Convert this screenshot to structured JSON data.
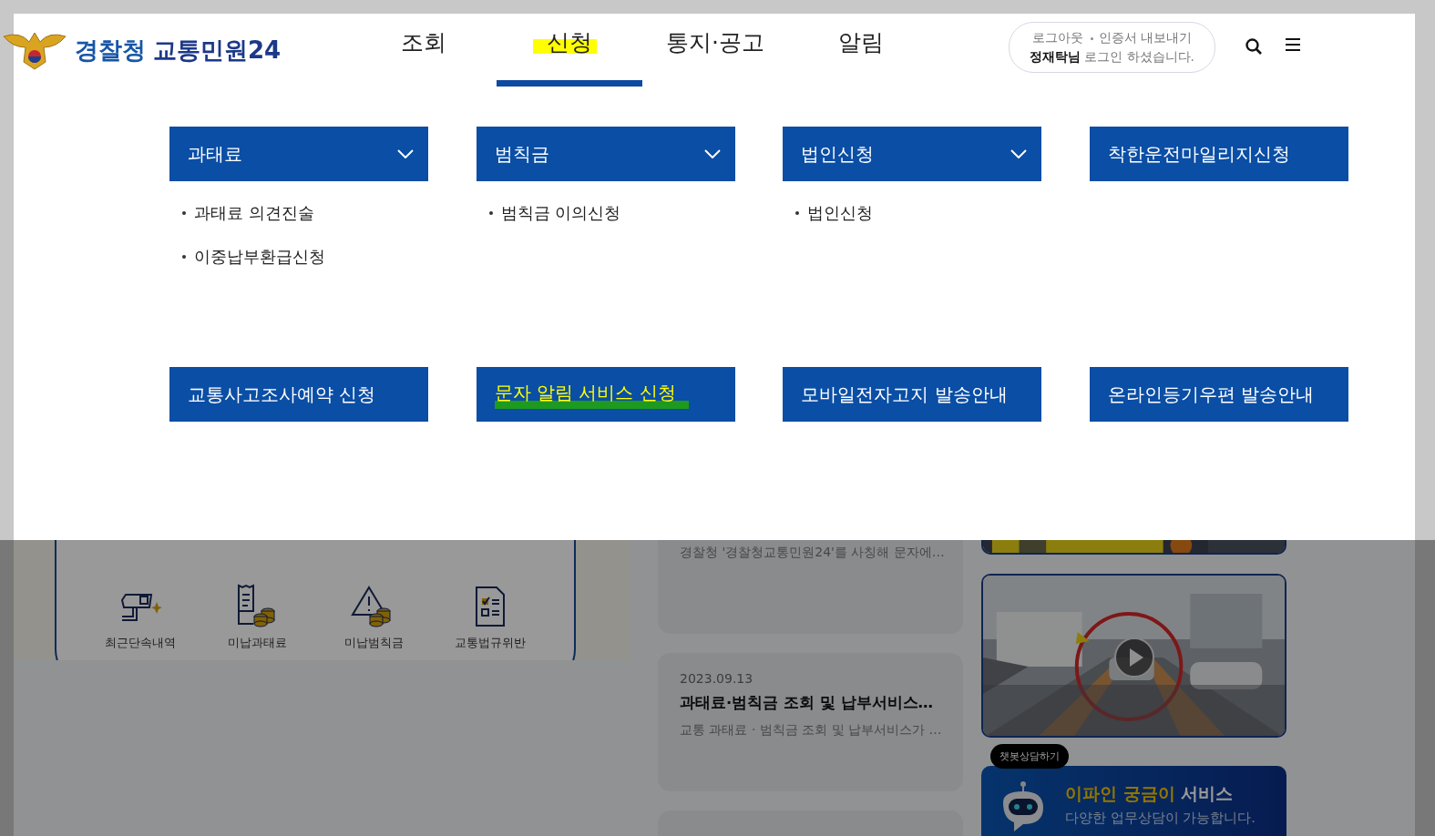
{
  "logo": {
    "agency": "경찰청",
    "service": "교통민원24"
  },
  "nav": [
    {
      "label": "조회",
      "selected": false,
      "highlighted": false
    },
    {
      "label": "신청",
      "selected": true,
      "highlighted": true
    },
    {
      "label": "통지·공고",
      "selected": false,
      "highlighted": false
    },
    {
      "label": "알림",
      "selected": false,
      "highlighted": false
    }
  ],
  "account": {
    "logout": "로그아웃",
    "export_certificate": "인증서 내보내기",
    "user": "정재탁님",
    "status": "로그인 하셨습니다."
  },
  "menu": [
    {
      "label": "과태료",
      "expandable": true,
      "highlighted": false,
      "items": [
        "과태료 의견진술",
        "이중납부환급신청"
      ]
    },
    {
      "label": "범칙금",
      "expandable": true,
      "highlighted": false,
      "items": [
        "범칙금 이의신청"
      ]
    },
    {
      "label": "법인신청",
      "expandable": true,
      "highlighted": false,
      "items": [
        "법인신청"
      ]
    },
    {
      "label": "착한운전마일리지신청",
      "expandable": false,
      "highlighted": false
    },
    {
      "label": "교통사고조사예약 신청",
      "expandable": false,
      "highlighted": false
    },
    {
      "label": "문자 알림 서비스 신청",
      "expandable": false,
      "highlighted": true
    },
    {
      "label": "모바일전자고지 발송안내",
      "expandable": false,
      "highlighted": false
    },
    {
      "label": "온라인등기우편 발송안내",
      "expandable": false,
      "highlighted": false
    }
  ],
  "quick_menu": [
    {
      "label": "최근단속내역",
      "kind": "camera"
    },
    {
      "label": "미납과태료",
      "kind": "receipt"
    },
    {
      "label": "미납범칙금",
      "kind": "warning"
    },
    {
      "label": "교통법규위반",
      "kind": "checklist"
    }
  ],
  "news": [
    {
      "summary": "경찰청 '경찰청교통민원24'를 사칭해 문자에…"
    },
    {
      "date": "2023.09.13",
      "title": "과태료·범칙금 조회 및 납부서비스…",
      "summary": "교통 과태료 · 범칙금 조회 및 납부서비스가 …"
    }
  ],
  "chatbot": {
    "bubble": "챗봇상담하기",
    "title_accent": "이파인 궁금이",
    "title_rest": "서비스",
    "subtitle": "다양한 업무상담이 가능합니다."
  }
}
